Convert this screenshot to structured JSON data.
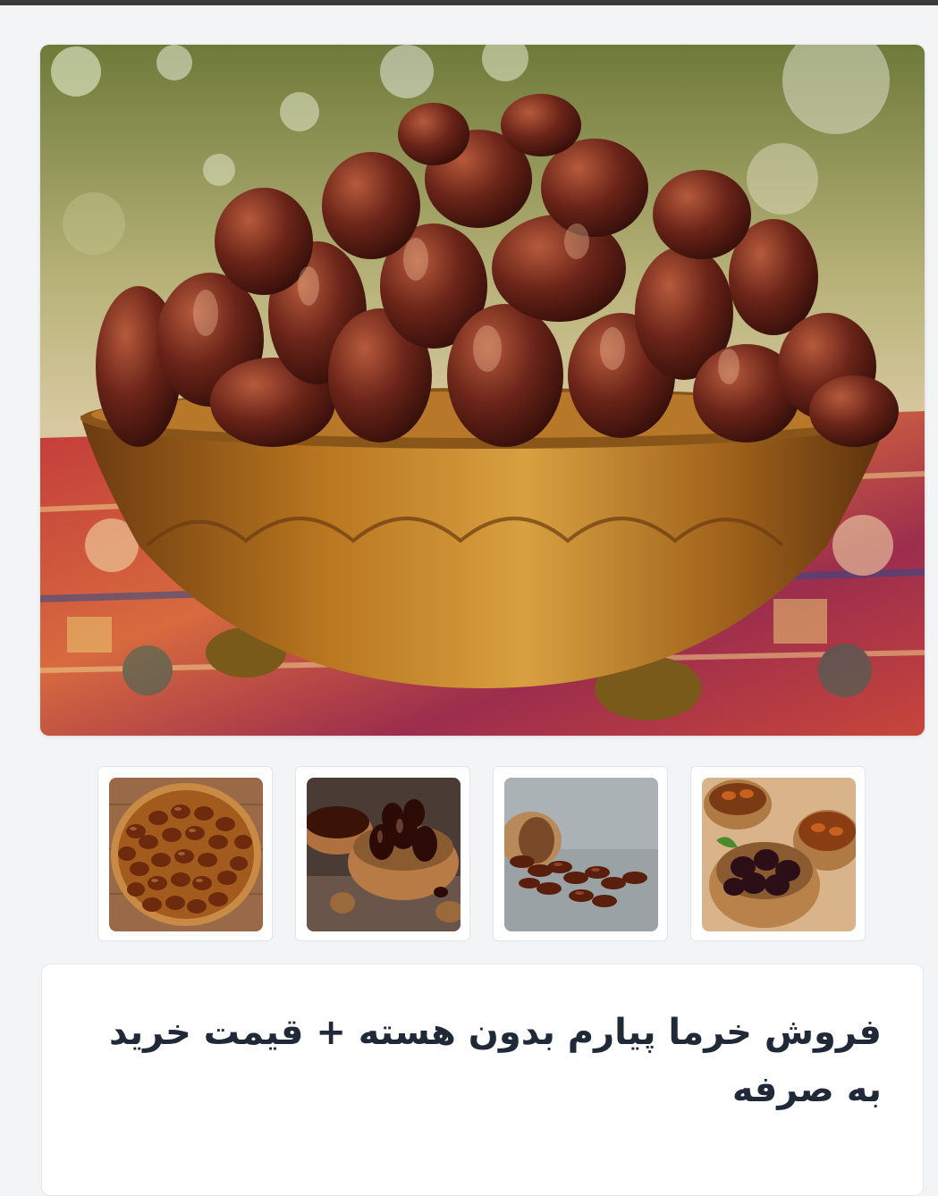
{
  "product": {
    "title": "فروش خرما پیارم بدون هسته + قیمت خرید به صرفه",
    "main_image": "photo-dates-in-brass-bowl",
    "thumbnails": [
      {
        "icon": "photo-dates-platter"
      },
      {
        "icon": "photo-dates-wooden-bowls-walnuts"
      },
      {
        "icon": "photo-dates-spilled-bowl"
      },
      {
        "icon": "photo-dates-assorted-bowls"
      }
    ]
  },
  "colors": {
    "background": "#f3f4f6",
    "card": "#ffffff",
    "title_text": "#1f2937",
    "date_brown": "#5a1f14"
  }
}
